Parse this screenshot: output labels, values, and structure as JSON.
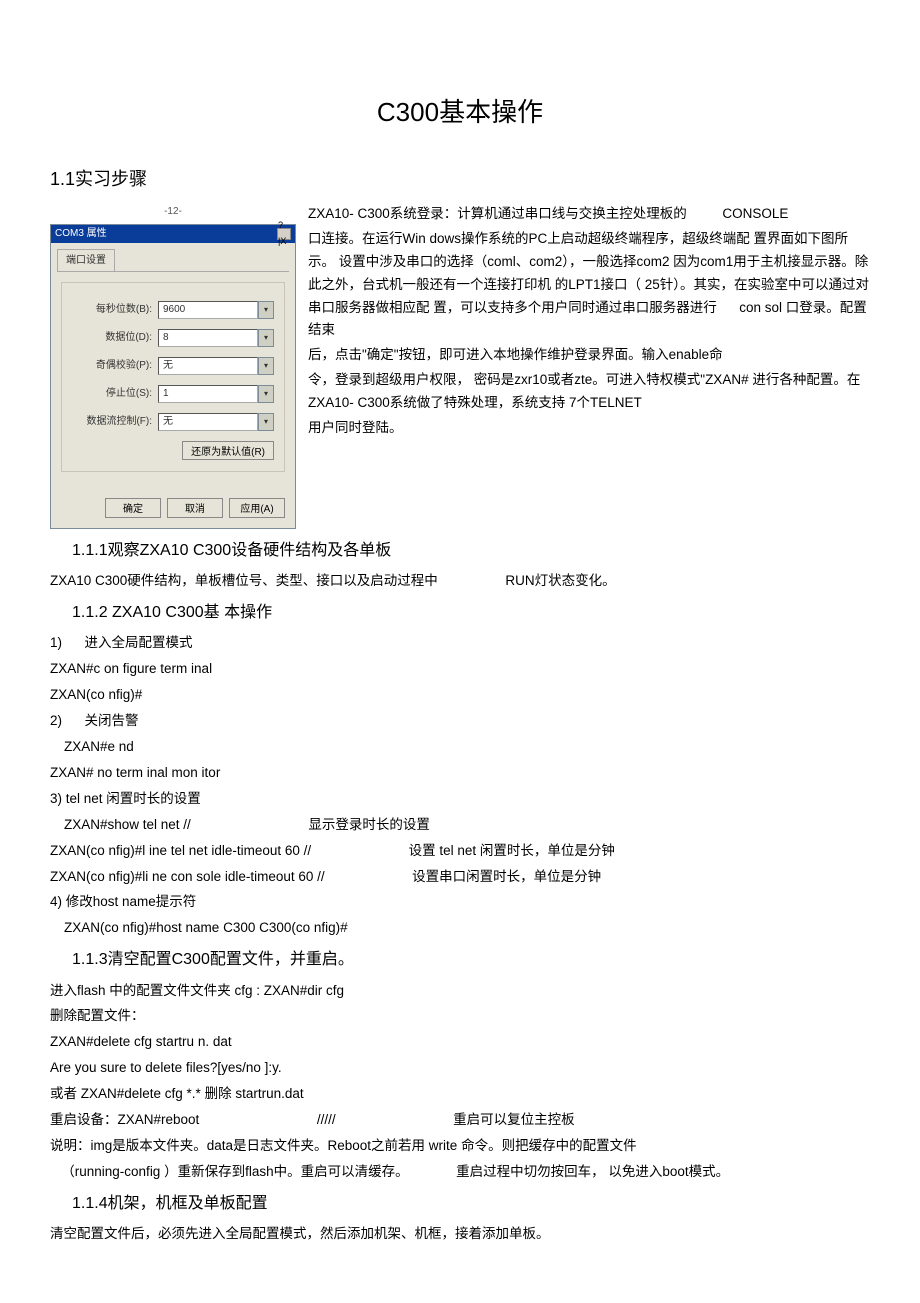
{
  "title": "C300基本操作",
  "sec1": "1.1实习步骤",
  "pagenum": "-12-",
  "dialog": {
    "title": "COM3 属性",
    "close": "?|X",
    "tab": "端口设置",
    "rows": [
      {
        "label": "每秒位数(B):",
        "value": "9600"
      },
      {
        "label": "数据位(D):",
        "value": "8"
      },
      {
        "label": "奇偶校验(P):",
        "value": "无"
      },
      {
        "label": "停止位(S):",
        "value": "1"
      },
      {
        "label": "数据流控制(F):",
        "value": "无"
      }
    ],
    "restore": "还原为默认值(R)",
    "btn_ok": "确定",
    "btn_cancel": "取消",
    "btn_apply": "应用(A)"
  },
  "intro": {
    "p1a": "ZXA10- C300系统登录：计算机通过串口线与交换主控处理板的",
    "p1b": "CONSOLE",
    "p2": "口连接。在运行Win dows操作系统的PC上启动超级终端程序，超级终端配  置界面如下图所示。  设置中涉及串口的选择（coml、com2），一般选择com2 因为com1用于主机接显示器。除此之外，台式机一般还有一个连接打印机  的LPT1接口（ 25针）。其实，在实验室中可以通过对串口服务器做相应配   置，可以支持多个用户同时通过串口服务器进行",
    "p2b": "con sol 口登录。配置结束",
    "p3": "后，点击\"确定\"按钮，即可进入本地操作维护登录界面。输入enable命",
    "p4": "令，登录到超级用户权限，  密码是zxr10或者zte。可进入特权模式\"ZXAN# 进行各种配置。在  ZXA10- C300系统做了特殊处理，系统支持   7个TELNET",
    "p5": "用户同时登陆。"
  },
  "s111_title": "1.1.1观察ZXA10 C300设备硬件结构及各单板",
  "s111_p1a": "ZXA10 C300硬件结构，单板槽位号、类型、接口以及启动过程中",
  "s111_p1b": "RUN灯状态变化。",
  "s112_title": "1.1.2 ZXA10 C300基  本操作",
  "step1_n": "1)",
  "step1_t": "进入全局配置模式",
  "step1_c1": "ZXAN#c on figure term inal",
  "step1_c2": "ZXAN(co nfig)#",
  "step2_n": "2)",
  "step2_t": "关闭告警",
  "step2_c1": "ZXAN#e nd",
  "step2_c2": "ZXAN# no term inal mon itor",
  "step3_t": "3)  tel net 闲置时长的设置",
  "step3_c1a": "ZXAN#show tel net //",
  "step3_c1b": "显示登录时长的设置",
  "step3_c2a": "ZXAN(co nfig)#l ine tel net idle-timeout 60 //",
  "step3_c2b": "设置  tel net 闲置时长，单位是分钟",
  "step3_c3a": "ZXAN(co nfig)#li ne con sole idle-timeout 60 //",
  "step3_c3b": "设置串口闲置时长，单位是分钟",
  "step4_t": "4)  修改host name提示符",
  "step4_c1": "ZXAN(co nfig)#host name C300       C300(co nfig)#",
  "s113_title": "1.1.3清空配置C300配置文件，并重启。",
  "s113_p1": "进入flash 中的配置文件文件夹  cfg :   ZXAN#dir cfg",
  "s113_p2": "删除配置文件：",
  "s113_p3": "ZXAN#delete cfg startru n. dat",
  "s113_p4": "Are you sure to delete files?[yes/no ]:y.",
  "s113_p5": "或者  ZXAN#delete cfg *.* 删除  startrun.dat",
  "s113_p6a": "重启设备：ZXAN#reboot",
  "s113_p6b": "/////",
  "s113_p6c": "重启可以复位主控板",
  "s113_p7": "说明：img是版本文件夹。data是日志文件夹。Reboot之前若用  write 命令。则把缓存中的配置文件",
  "s113_p8a": "（running-config     ）重新保存到flash中。重启可以清缓存。",
  "s113_p8b": "重启过程中切勿按回车，    以免进入boot模式。",
  "s114_title": "1.1.4机架，机框及单板配置",
  "s114_p1": "清空配置文件后，必须先进入全局配置模式，然后添加机架、机框，接着添加单板。"
}
